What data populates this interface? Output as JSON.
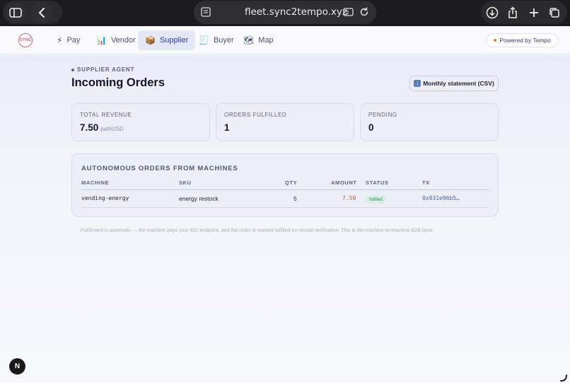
{
  "browser": {
    "url": "fleet.sync2tempo.xyz",
    "icons": [
      "sidebar-icon",
      "back-icon",
      "tab-layout-icon",
      "reader-icon",
      "reload-icon",
      "download-icon",
      "share-icon",
      "new-tab-icon",
      "tabs-overview-icon"
    ]
  },
  "nav": {
    "logo_text": "SYNC",
    "items": [
      {
        "label": "Pay",
        "icon": "⚡"
      },
      {
        "label": "Vendor",
        "icon": "📊"
      },
      {
        "label": "Supplier",
        "icon": "📦",
        "active": true
      },
      {
        "label": "Buyer",
        "icon": "🧾"
      },
      {
        "label": "Map",
        "icon": "🗺"
      }
    ],
    "powered_label": "Powered by Tempo"
  },
  "page": {
    "eyebrow": "SUPPLIER AGENT",
    "title": "Incoming Orders",
    "csv_button": "Monthly statement (CSV)"
  },
  "stats": [
    {
      "label": "TOTAL REVENUE",
      "value": "7.50",
      "unit": "pathUSD"
    },
    {
      "label": "ORDERS FULFILLED",
      "value": "1"
    },
    {
      "label": "PENDING",
      "value": "0"
    }
  ],
  "orders": {
    "title": "AUTONOMOUS ORDERS FROM MACHINES",
    "columns": [
      "MACHINE",
      "SKU",
      "QTY",
      "AMOUNT",
      "STATUS",
      "TX"
    ],
    "rows": [
      {
        "machine": "vending-energy",
        "sku": "energy restock",
        "qty": "5",
        "amount": "7.50",
        "status": "fulfilled",
        "tx": "0x931e96b5…"
      }
    ]
  },
  "footnote": "Fulfillment is automatic — the machine pays your 402 endpoint, and the order is marked fulfilled on receipt verification. This is the machine-to-machine B2B layer.",
  "dev_badge": "N",
  "colors": {
    "accent": "#2b3aa0",
    "amount": "#c06a3a",
    "status_fulfilled": "#2f8a5c",
    "brand_dot": "#e0823a"
  }
}
